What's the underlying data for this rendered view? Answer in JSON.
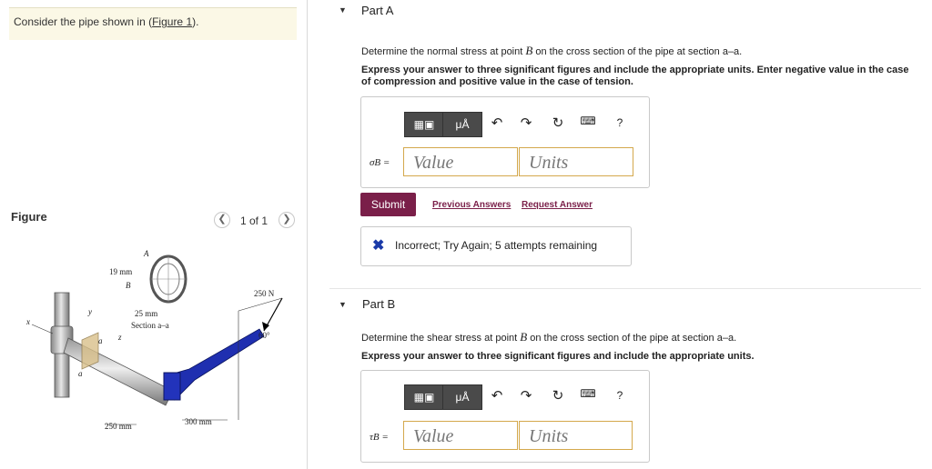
{
  "left": {
    "prompt_prefix": "Consider the pipe shown in (",
    "prompt_link": "Figure 1",
    "prompt_suffix": ").",
    "figure_label": "Figure",
    "pagination": "1 of 1",
    "prev_icon": "chevron-left-icon",
    "next_icon": "chevron-right-icon"
  },
  "figure": {
    "labels": [
      "A",
      "19 mm",
      "B",
      "25 mm",
      "Section a–a",
      "250 N",
      "60°",
      "x",
      "y",
      "z",
      "a",
      "a",
      "250 mm",
      "300 mm"
    ]
  },
  "partA": {
    "title": "Part A",
    "question_pre": "Determine the normal stress at point ",
    "question_var": "B",
    "question_post": " on the cross section of the pipe at section a–a.",
    "instructions": "Express your answer to three significant figures and include the appropriate units. Enter negative value in the case of compression and positive value in the case of tension.",
    "mu_label": "μÅ",
    "help_label": "?",
    "var_label": "σB =",
    "value_placeholder": "Value",
    "units_placeholder": "Units",
    "submit_label": "Submit",
    "previous_answers": "Previous Answers",
    "request_answer": "Request Answer",
    "feedback": "Incorrect; Try Again; 5 attempts remaining",
    "feedback_color": "#1a3aa8"
  },
  "partB": {
    "title": "Part B",
    "question_pre": "Determine the shear stress at point ",
    "question_var": "B",
    "question_post": " on the cross section of the pipe at section a–a.",
    "instructions": "Express your answer to three significant figures and include the appropriate units.",
    "mu_label": "μÅ",
    "help_label": "?",
    "var_label": "τB =",
    "value_placeholder": "Value",
    "units_placeholder": "Units"
  },
  "colors": {
    "accent": "#7a1f49",
    "input_border": "#d4a84c",
    "wrench": "#1f2fb0"
  }
}
